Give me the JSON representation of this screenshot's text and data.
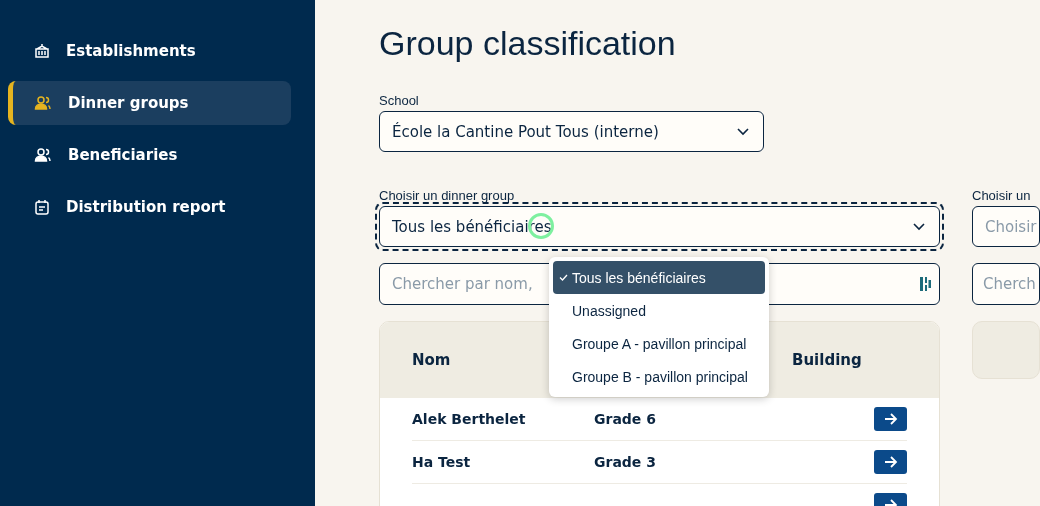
{
  "sidebar": {
    "items": [
      {
        "label": "Establishments",
        "selected": false
      },
      {
        "label": "Dinner groups",
        "selected": true
      },
      {
        "label": "Beneficiaries",
        "selected": false
      },
      {
        "label": "Distribution report",
        "selected": false
      }
    ]
  },
  "title": "Group classification",
  "school": {
    "label": "School",
    "value": "École la Cantine Pout Tous (interne)"
  },
  "left_panel": {
    "group_label": "Choisir un dinner group",
    "group_value": "Tous les bénéficiaires",
    "focused": true,
    "search": {
      "placeholder": "Chercher par nom,"
    },
    "dropdown": {
      "options": [
        {
          "label": "Tous les bénéficiaires",
          "selected": true
        },
        {
          "label": "Unassigned",
          "selected": false
        },
        {
          "label": "Groupe A - pavillon principal",
          "selected": false
        },
        {
          "label": "Groupe B - pavillon principal",
          "selected": false
        }
      ]
    },
    "table": {
      "columns": [
        "Nom",
        "Building"
      ],
      "rows": [
        {
          "name": "Alek Berthelet",
          "grade": "Grade 6"
        },
        {
          "name": "Ha Test",
          "grade": "Grade 3"
        },
        {}
      ]
    }
  },
  "right_panel": {
    "group_label": "Choisir un",
    "group_placeholder": "Choisir",
    "search": {
      "placeholder": "Cherch"
    }
  }
}
